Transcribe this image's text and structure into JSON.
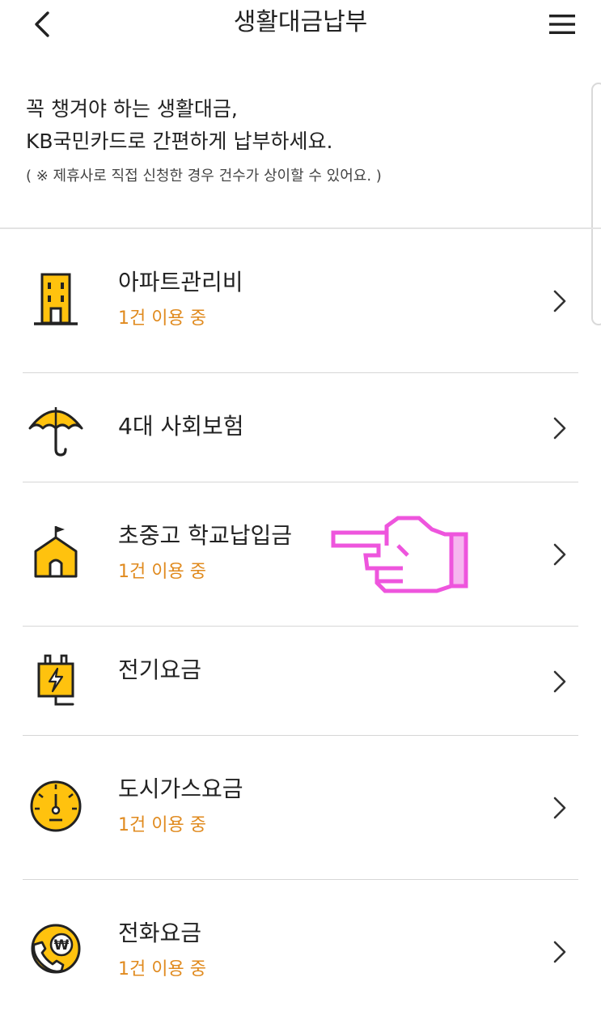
{
  "header": {
    "title": "생활대금납부",
    "back_icon": "chevron-left-icon",
    "menu_icon": "hamburger-menu-icon"
  },
  "intro": {
    "line1": "꼭 챙겨야 하는 생활대금,",
    "line2": "KB국민카드로 간편하게 납부하세요.",
    "note": "( ※ 제휴사로 직접 신청한 경우 건수가 상이할 수 있어요. )"
  },
  "items": [
    {
      "name": "아파트관리비",
      "status": "1건 이용 중",
      "icon": "apartment-building-icon"
    },
    {
      "name": "4대 사회보험",
      "status": "",
      "icon": "umbrella-icon"
    },
    {
      "name": "초중고 학교납입금",
      "status": "1건 이용 중",
      "icon": "school-icon"
    },
    {
      "name": "전기요금",
      "status": "",
      "icon": "electric-plug-icon"
    },
    {
      "name": "도시가스요금",
      "status": "1건 이용 중",
      "icon": "gas-gauge-icon"
    },
    {
      "name": "전화요금",
      "status": "1건 이용 중",
      "icon": "phone-won-icon"
    }
  ],
  "colors": {
    "accent_yellow": "#FFC20E",
    "status_orange": "#E08A1E",
    "text_dark": "#222222",
    "pointer_pink": "#EE55DD"
  },
  "annotation": {
    "icon": "pointing-hand-icon"
  }
}
